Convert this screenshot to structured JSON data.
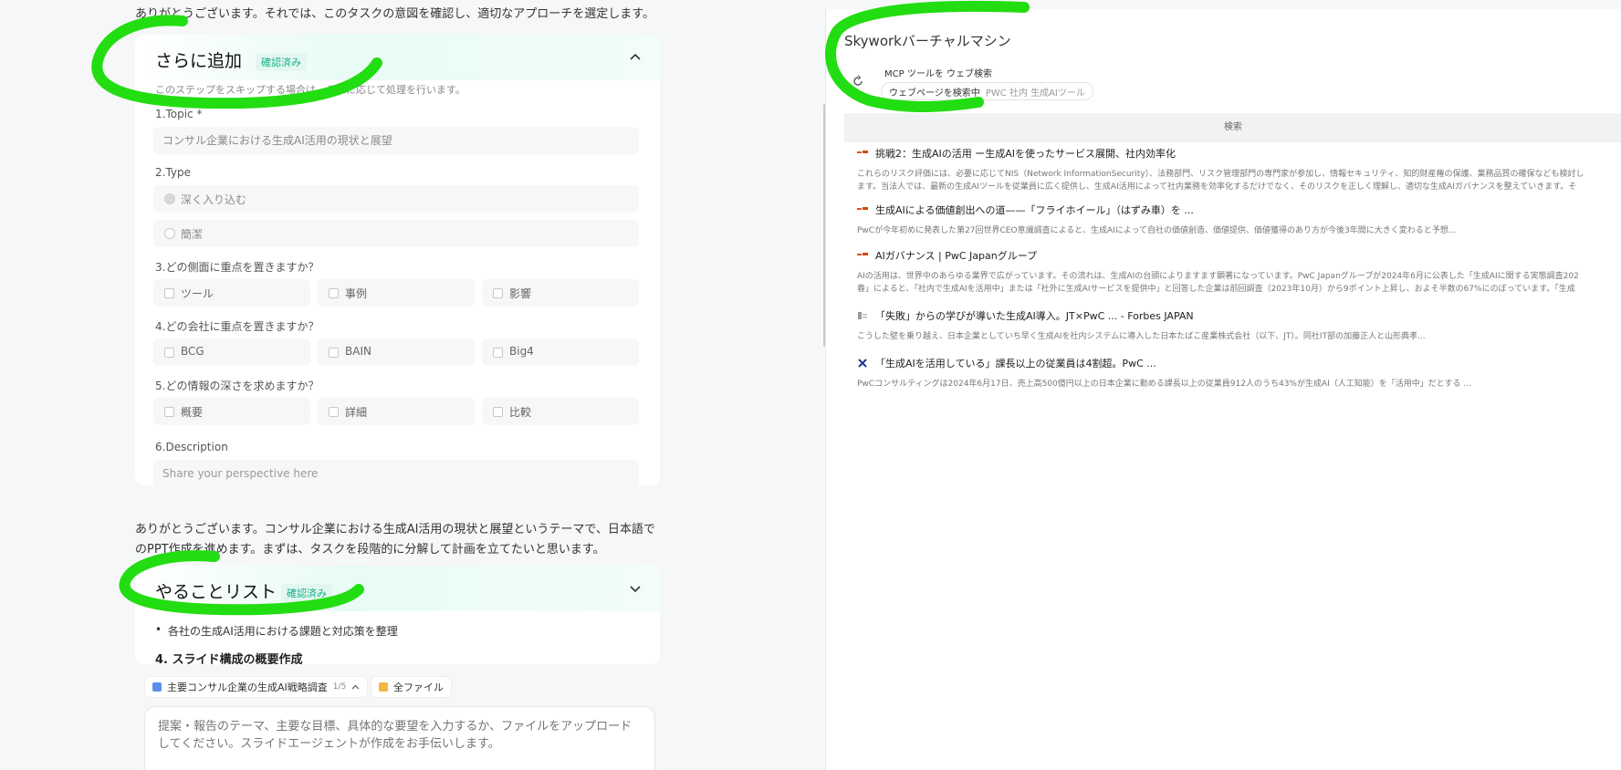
{
  "left": {
    "intro_top": "ありがとうございます。それでは、このタスクの意図を確認し、適切なアプローチを選定します。",
    "more_card": {
      "title": "さらに追加",
      "badge": "確認済み",
      "helper": "このステップをスキップする場合は、それに応じて処理を行います。",
      "q1": {
        "label": "1.Topic *",
        "value": "コンサル企業における生成AI活用の現状と展望"
      },
      "q2": {
        "label": "2.Type",
        "options": [
          "深く入り込む",
          "簡潔"
        ]
      },
      "q3": {
        "label": "3.どの側面に重点を置きますか？",
        "options": [
          "ツール",
          "事例",
          "影響"
        ]
      },
      "q4": {
        "label": "4.どの会社に重点を置きますか？",
        "options": [
          "BCG",
          "BAIN",
          "Big4"
        ]
      },
      "q5": {
        "label": "5.どの情報の深さを求めますか？",
        "options": [
          "概要",
          "詳細",
          "比較"
        ]
      },
      "q6": {
        "label": "6.Description",
        "placeholder": "Share your perspective here"
      }
    },
    "para2": "ありがとうございます。コンサル企業における生成AI活用の現状と展望というテーマで、日本語でのPPT作成を進めます。まずは、タスクを段階的に分解して計画を立てたいと思います。",
    "todo_card": {
      "title": "やることリスト",
      "badge": "確認済み",
      "bullet": "各社の生成AI活用における課題と対応策を整理",
      "subheading": "4. スライド構成の概要作成"
    },
    "chips": {
      "task": "主要コンサル企業の生成AI戦略調査",
      "task_count": "1/5",
      "files": "全ファイル"
    },
    "composer": {
      "placeholder": "提案・報告のテーマ、主要な目標、具体的な要望を入力するか、ファイルをアップロードしてください。スライドエージェントが作成をお手伝いします。"
    }
  },
  "right": {
    "title": "Skyworkバーチャルマシン",
    "tool_line": "MCP ツールを ウェブ検索",
    "status_main": "ウェブページを検索中",
    "status_query": "PWC 社内 生成AIツール",
    "search_label": "検索",
    "results": [
      {
        "icon": "pwc-logo-icon",
        "title": "挑戦2：生成AIの活用 ー生成AIを使ったサービス展開、社内効率化",
        "snippet_1": "これらのリスク評価には、必要に応じてNIS（Network InformationSecurity）、法務部門、リスク管理部門の専門家が参加し、情報セキュリティ、知的財産権の保護、業務品質の確保なども検討し",
        "snippet_2": "ます。当法人では、最新の生成AIツールを従業員に広く提供し、生成AI活用によって社内業務を効率化するだけでなく、そのリスクを正しく理解し、適切な生成AIガバナンスを整えていきます。そ"
      },
      {
        "icon": "pwc-logo-icon",
        "title": "生成AIによる価値創出への道——「フライホイール」（はずみ車）を ...",
        "snippet_1": "PwCが今年初めに発表した第27回世界CEO意識調査によると、生成AIによって自社の価値創造、価値提供、価値獲得のあり方が今後3年間に大きく変わると予想..."
      },
      {
        "icon": "pwc-logo-icon",
        "title": "AIガバナンス | PwC Japanグループ",
        "snippet_1": "AIの活用は、世界中のあらゆる業界で広がっています。その流れは、生成AIの台頭によりますます顕著になっています。PwC Japanグループが2024年6月に公表した「生成AIに関する実態調査202",
        "snippet_2": "春」によると、「社内で生成AIを活用中」または「社外に生成AIサービスを提供中」と回答した企業は前回調査（2023年10月）から9ポイント上昇し、およそ半数の67%にのぼっています。「生成"
      },
      {
        "icon": "forbes-icon",
        "title": "「失敗」からの学びが導いた生成AI導入。JT×PwC ... - Forbes JAPAN",
        "snippet_1": "こうした壁を乗り越え、日本企業としていち早く生成AIを社内システムに導入した日本たばこ産業株式会社（以下、JT）。同社IT部の加藤正人と山形典孝..."
      },
      {
        "icon": "x-icon",
        "title": "「生成AIを活用している」課長以上の従業員は4割超。PwC ...",
        "snippet_1": "PwCコンサルティングは2024年6月17日、売上高500億円以上の日本企業に勤める課長以上の従業員912人のうち43%が生成AI（人工知能）を「活用中」だとする ..."
      }
    ]
  },
  "colors": {
    "accent_green": "#17b08a",
    "scribble_green": "#22dd11"
  }
}
